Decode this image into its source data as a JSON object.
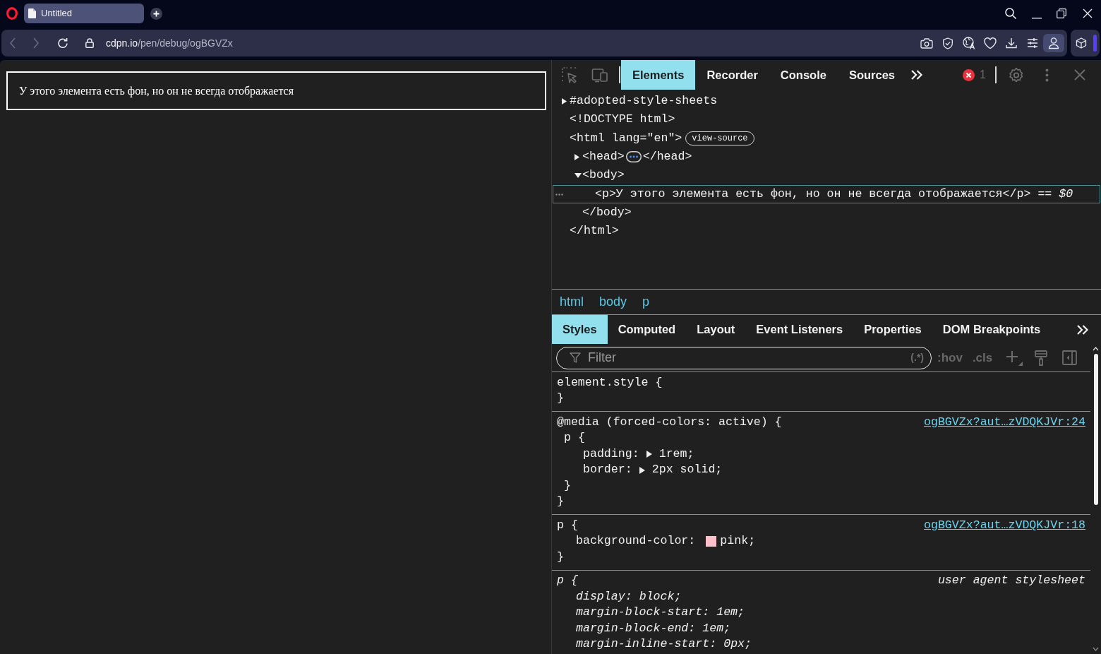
{
  "browser": {
    "tabs": [
      {
        "title": "Untitled",
        "selected": true
      }
    ],
    "address": {
      "host": "cdpn.io",
      "path": "/pen/debug/ogBGVZx"
    }
  },
  "page": {
    "paragraph": "У этого элемента есть фон, но он не всегда отображается"
  },
  "devtools": {
    "tabs": [
      {
        "label": "Elements",
        "selected": true
      },
      {
        "label": "Recorder",
        "selected": false
      },
      {
        "label": "Console",
        "selected": false
      },
      {
        "label": "Sources",
        "selected": false
      }
    ],
    "error_count": "1",
    "dom_tree": [
      {
        "text": "#adopted-style-sheets",
        "expanded": false,
        "selected": false
      },
      {
        "text": "<!DOCTYPE html>",
        "selected": false
      },
      {
        "text": "<html lang=\"en\">",
        "badge": "view-source",
        "closing": "</html>",
        "selected": false,
        "children": [
          {
            "text": "<head>",
            "closing": "</head>",
            "expanded": false,
            "selected": false
          },
          {
            "text": "<body>",
            "closing": "</body>",
            "expanded": true,
            "selected": false,
            "children": [
              {
                "text": "<p>У этого элемента есть фон, но он не всегда отображается</p>",
                "selected": true,
                "suffix": "== *$0*"
              }
            ]
          }
        ]
      }
    ],
    "breadcrumbs": [
      "html",
      "body",
      "p"
    ],
    "sidebar_tabs": [
      {
        "label": "Styles",
        "selected": true
      },
      {
        "label": "Computed",
        "selected": false
      },
      {
        "label": "Layout",
        "selected": false
      },
      {
        "label": "Event Listeners",
        "selected": false
      },
      {
        "label": "Properties",
        "selected": false
      },
      {
        "label": "DOM Breakpoints",
        "selected": false
      }
    ],
    "filter": {
      "placeholder": "Filter",
      "regex_toggle": "(.*)",
      "buttons": [
        ":hov",
        ".cls"
      ]
    },
    "rules": [
      {
        "kind": "author",
        "header": "element.style {",
        "footer": "}"
      },
      {
        "kind": "author",
        "header": "@media (forced-colors: active) {",
        "source": "ogBGVZx?aut…zVDQKJVr:24",
        "children": [
          {
            "kind": "author",
            "header": "p {",
            "declarations": [
              {
                "name": "padding:",
                "value": "1rem;",
                "expanded": false
              },
              {
                "name": "border:",
                "value": "2px solid;",
                "expanded": false
              }
            ],
            "footer": "}"
          }
        ],
        "footer": "}"
      },
      {
        "kind": "author",
        "header": "p {",
        "source": "ogBGVZx?aut…zVDQKJVr:18",
        "declarations": [
          {
            "name": "background-color:",
            "value": "pink;",
            "color": "#ffc0cb"
          }
        ],
        "footer": "}"
      },
      {
        "kind": "user_agent",
        "header": "p {",
        "source": "user agent stylesheet",
        "declarations": [
          {
            "name": "display:",
            "value": "block;"
          },
          {
            "name": "margin-block-start:",
            "value": "1em;"
          },
          {
            "name": "margin-block-end:",
            "value": "1em;"
          },
          {
            "name": "margin-inline-start:",
            "value": "0px;"
          }
        ]
      }
    ]
  }
}
